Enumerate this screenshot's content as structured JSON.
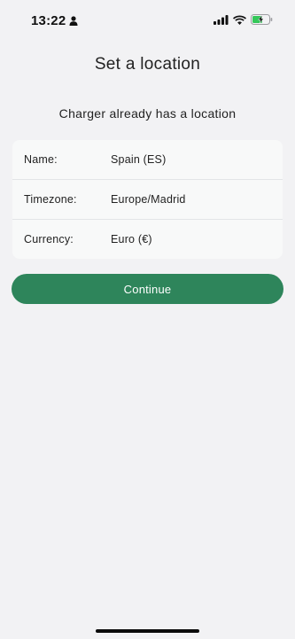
{
  "status_bar": {
    "time": "13:22",
    "person_icon": "person-icon",
    "signal_icon": "cellular-signal-icon",
    "wifi_icon": "wifi-icon",
    "battery_icon": "battery-charging-icon",
    "battery_color": "#34c759"
  },
  "header": {
    "title": "Set a location"
  },
  "main": {
    "subtitle": "Charger already has a location",
    "details": [
      {
        "label": "Name:",
        "value": "Spain (ES)"
      },
      {
        "label": "Timezone:",
        "value": "Europe/Madrid"
      },
      {
        "label": "Currency:",
        "value": "Euro (€)"
      }
    ],
    "continue_label": "Continue",
    "accent_color": "#2e855b"
  }
}
